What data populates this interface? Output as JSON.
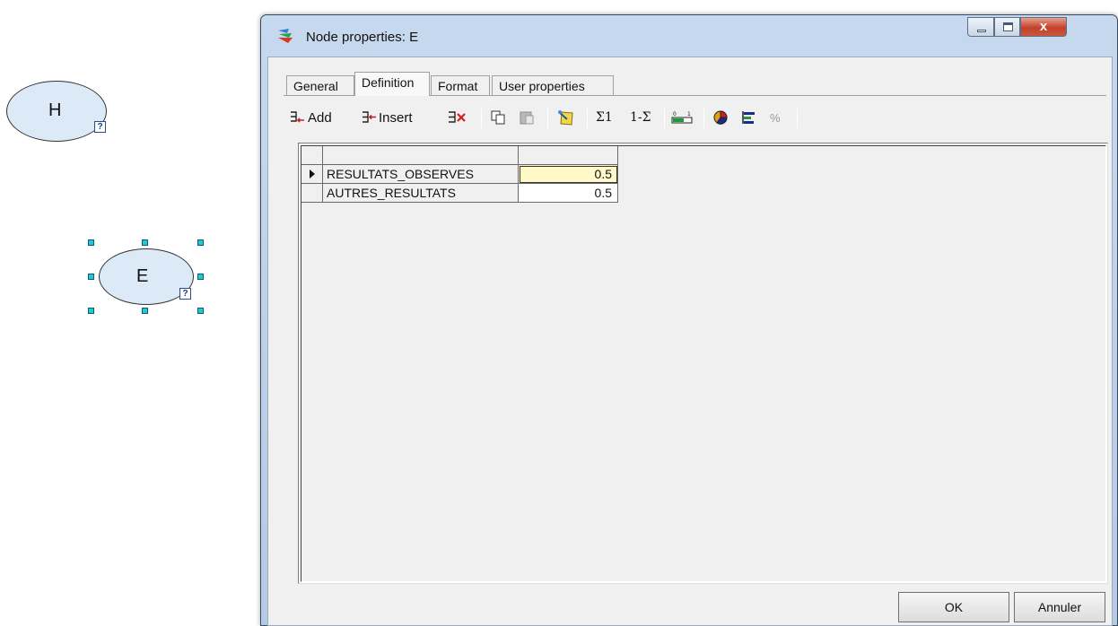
{
  "canvas": {
    "nodes": [
      {
        "name": "H",
        "badge": "?"
      },
      {
        "name": "E",
        "badge": "?"
      }
    ]
  },
  "dialog": {
    "title": "Node properties: E",
    "window_buttons": {
      "close": "x"
    },
    "tabs": [
      "General",
      "Definition",
      "Format",
      "User properties"
    ],
    "active_tab": "Definition",
    "toolbar": {
      "add_label": "Add",
      "insert_label": "Insert",
      "sum_to_one": "Σ1",
      "one_minus_sum": "1-Σ",
      "percent": "%"
    },
    "table": {
      "rows": [
        {
          "label": "RESULTATS_OBSERVES",
          "value": "0.5",
          "selected": true
        },
        {
          "label": "AUTRES_RESULTATS",
          "value": "0.5",
          "selected": false
        }
      ]
    },
    "buttons": {
      "ok": "OK",
      "cancel": "Annuler"
    }
  },
  "colors": {
    "node_fill": "#dce9f6",
    "selection_handle": "#23c8d8",
    "selected_cell": "#fff8c8",
    "title_bar": "#c6d9ee",
    "close_button": "#c2412a"
  },
  "icons": [
    "app-icon",
    "add-state-icon",
    "insert-state-icon",
    "delete-state-icon",
    "copy-icon",
    "paste-icon",
    "wizard-icon",
    "normalize-icon",
    "complement-icon",
    "discretize-icon",
    "pie-chart-icon",
    "bar-chart-icon",
    "percent-icon",
    "row-pointer-icon"
  ]
}
